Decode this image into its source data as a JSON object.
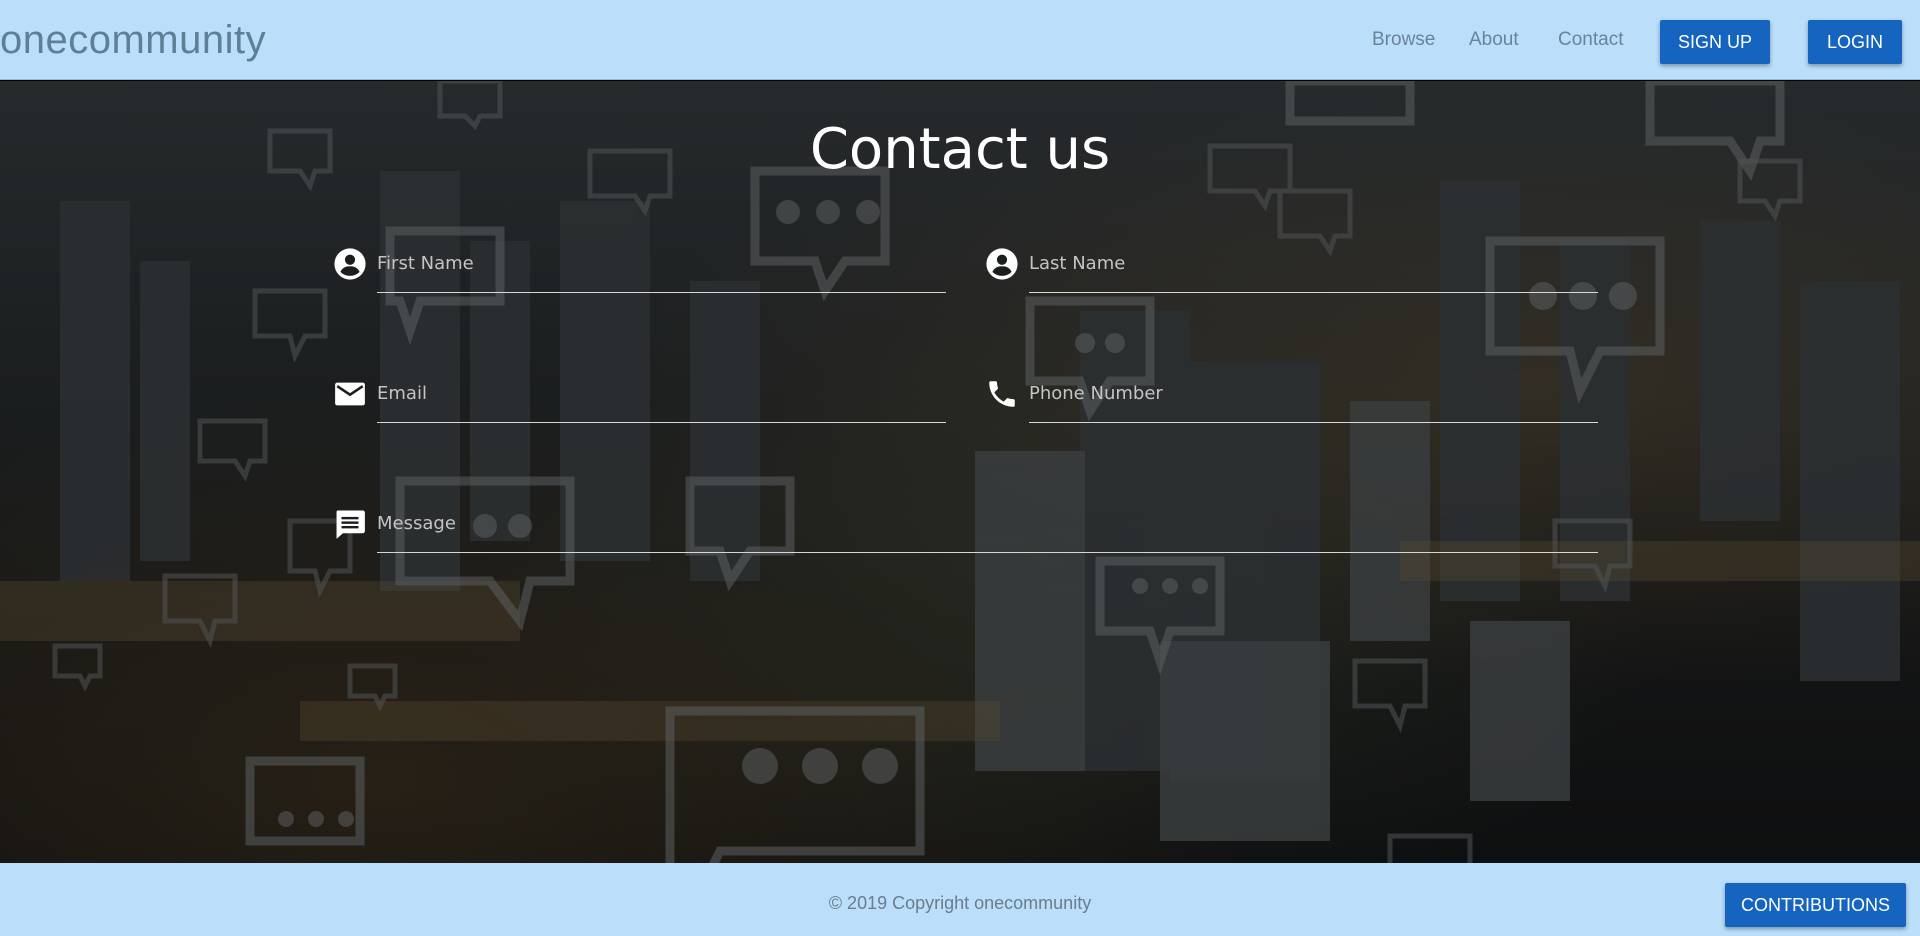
{
  "navbar": {
    "brand": "onecommunity",
    "links": [
      "Browse",
      "About",
      "Contact"
    ],
    "signup_label": "SIGN UP",
    "login_label": "LOGIN"
  },
  "hero": {
    "title": "Contact us"
  },
  "form": {
    "first_name_placeholder": "First Name",
    "last_name_placeholder": "Last Name",
    "email_placeholder": "Email",
    "phone_placeholder": "Phone Number",
    "message_placeholder": "Message"
  },
  "footer": {
    "copyright": "© 2019 Copyright onecommunity",
    "contributions_label": "CONTRIBUTIONS"
  },
  "colors": {
    "nav_bg": "#bbdefb",
    "button_bg": "#1565c0"
  }
}
